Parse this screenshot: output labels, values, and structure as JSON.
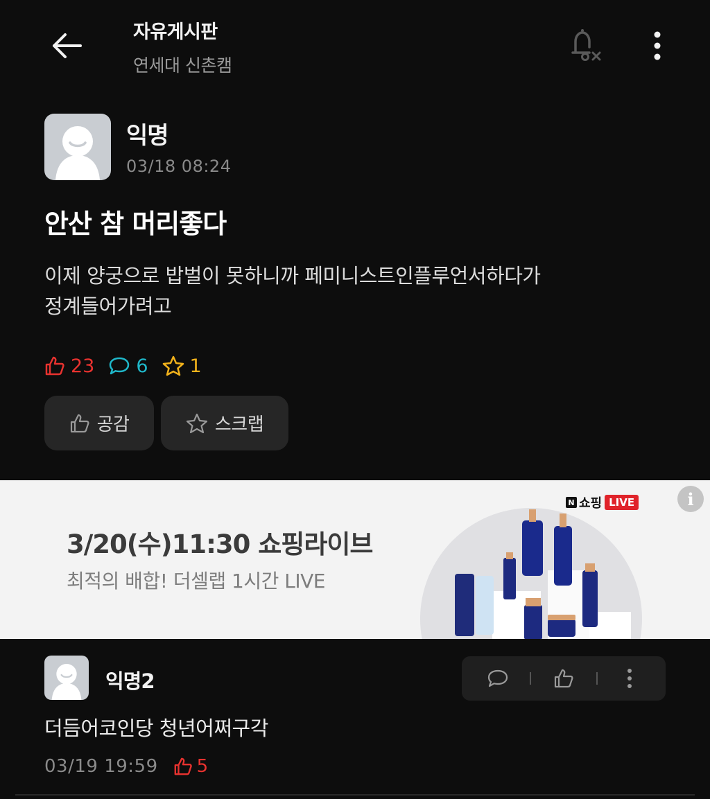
{
  "header": {
    "board_title": "자유게시판",
    "board_subtitle": "연세대 신촌캠"
  },
  "post": {
    "author": "익명",
    "time": "03/18 08:24",
    "title": "안산 참 머리좋다",
    "body_line1": "이제 양궁으로 밥벌이 못하니까 페미니스트인플루언서하다가",
    "body_line2": "정계들어가려고",
    "likes": "23",
    "comments": "6",
    "scraps": "1",
    "like_button_label": "공감",
    "scrap_button_label": "스크랩"
  },
  "ad": {
    "title": "3/20(수)11:30 쇼핑라이브",
    "subtitle": "최적의 배합! 더셀랩 1시간 LIVE",
    "badge_brand": "쇼핑",
    "badge_live": "LIVE",
    "info_symbol": "i"
  },
  "comment": {
    "author": "익명2",
    "text": "더듬어코인당 청년어쩌구각",
    "time": "03/19 19:59",
    "likes": "5"
  },
  "colors": {
    "background": "#0d0d0d",
    "like_red": "#e8322f",
    "comment_teal": "#1fb7c9",
    "scrap_yellow": "#f2b21b",
    "button_bg": "#262626"
  },
  "icons": [
    "back-arrow-icon",
    "notification-off-icon",
    "more-vertical-icon",
    "thumbs-up-icon",
    "comment-icon",
    "star-icon",
    "info-icon"
  ]
}
